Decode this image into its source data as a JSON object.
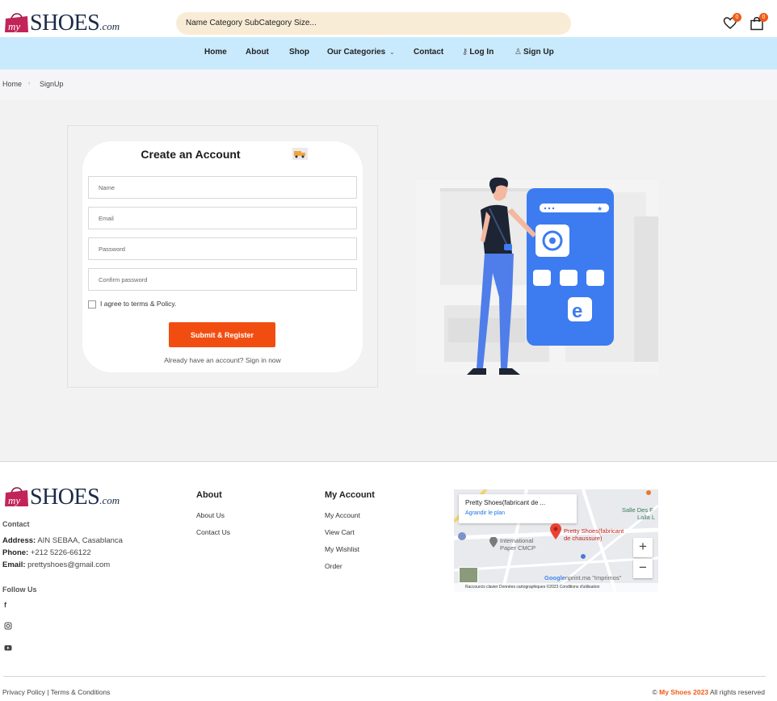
{
  "header": {
    "logo_prefix": "my",
    "logo_text": "SHOES",
    "logo_suffix": ".com",
    "search_placeholder": "Name Category SubCategory Size...",
    "wishlist_count": "0",
    "cart_count": "0"
  },
  "nav": {
    "items": [
      "Home",
      "About",
      "Shop",
      "Our Categories",
      "Contact",
      "Log In",
      "Sign Up"
    ]
  },
  "breadcrumb": [
    "Home",
    "SignUp"
  ],
  "form": {
    "title": "Create an Account",
    "name_placeholder": "Name",
    "email_placeholder": "Email",
    "password_placeholder": "Password",
    "confirm_placeholder": "Confirm password",
    "agree_label": "I agree to terms & Policy.",
    "submit_label": "Submit & Register",
    "signin_text": "Already have an account? Sign in now"
  },
  "footer": {
    "contact_heading": "Contact",
    "address_label": "Address:",
    "address_value": "AIN SEBAA, Casablanca",
    "phone_label": "Phone:",
    "phone_value": "+212 5226-66122",
    "email_label": "Email:",
    "email_value": "prettyshoes@gmail.com",
    "follow_heading": "Follow Us",
    "about_heading": "About",
    "about_links": [
      "About Us",
      "Contact Us"
    ],
    "account_heading": "My Account",
    "account_links": [
      "My Account",
      "View Cart",
      "My Wishlist",
      "Order"
    ],
    "legal": "Privacy Policy | Terms & Conditions",
    "copyright_prefix": "©",
    "copyright_brand": "My Shoes 2023",
    "copyright_suffix": "All rights reserved"
  },
  "map": {
    "place_title": "Pretty Shoes(fabricant de ...",
    "enlarge_link": "Agrandir le plan",
    "pin_label_1": "Pretty Shoes(fabricant",
    "pin_label_2": "de chaussure)",
    "poi_1_line1": "International",
    "poi_1_line2": "Paper CMCP",
    "poi_2_line1": "Salle Des F",
    "poi_2_line2": "Lalla L",
    "poi_3": "Imprimos",
    "poi_3_prefix": "nprint.ma",
    "google": "Google",
    "footer_text": "Raccourcis clavier   Données cartographiques ©2023   Conditions d'utilisation",
    "zoom_in": "+",
    "zoom_out": "−"
  },
  "colors": {
    "accent": "#f24d11",
    "nav_bg": "#c8eafc",
    "search_bg": "#f9ecd7",
    "phone_blue": "#3d7bf0"
  }
}
